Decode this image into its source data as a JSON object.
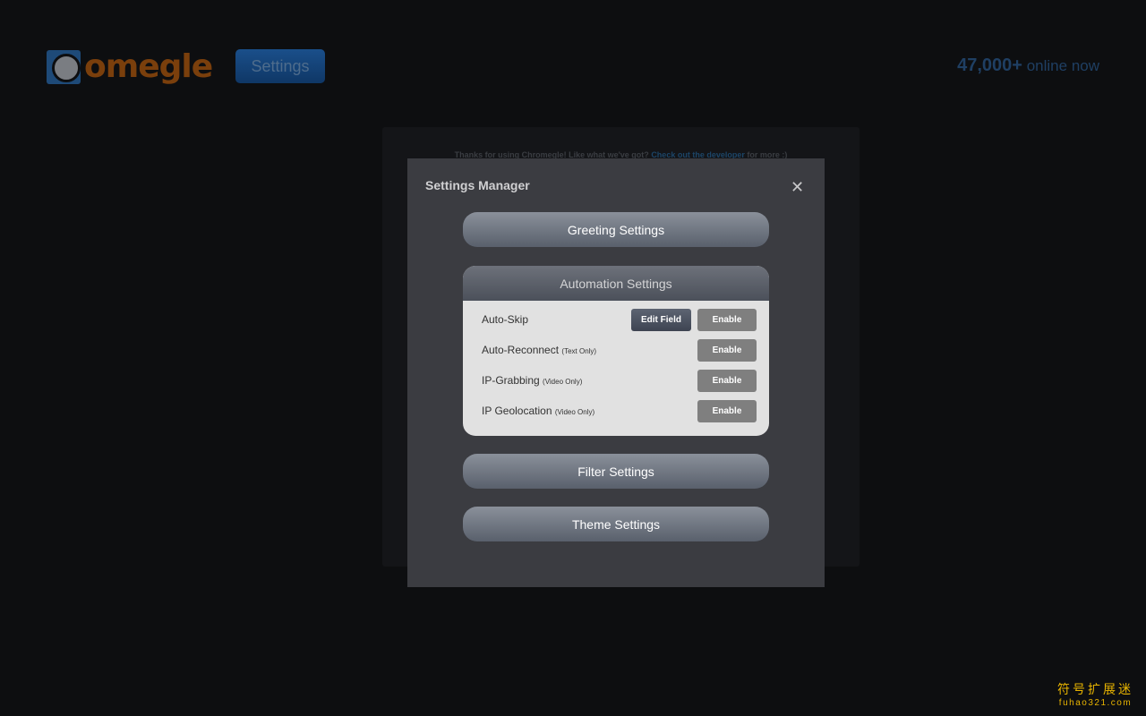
{
  "header": {
    "logo_text": "omegle",
    "settings_label": "Settings",
    "online_count": "47,000+",
    "online_suffix": "online now"
  },
  "background": {
    "note_prefix": "Thanks for using Chromegle! Like what we've got?",
    "note_link": "Check out the developer",
    "note_suffix": "for more :)"
  },
  "modal": {
    "title": "Settings Manager",
    "close_icon": "close-icon",
    "sections": {
      "greeting": "Greeting Settings",
      "automation": "Automation Settings",
      "filter": "Filter Settings",
      "theme": "Theme Settings"
    },
    "automation_rows": [
      {
        "label": "Auto-Skip",
        "note": "",
        "edit": "Edit Field",
        "button": "Enable"
      },
      {
        "label": "Auto-Reconnect",
        "note": "(Text Only)",
        "button": "Enable"
      },
      {
        "label": "IP-Grabbing",
        "note": "(Video Only)",
        "button": "Enable"
      },
      {
        "label": "IP Geolocation",
        "note": "(Video Only)",
        "button": "Enable"
      }
    ]
  },
  "watermark": {
    "line1": "符号扩展迷",
    "line2": "fuhao321.com"
  }
}
